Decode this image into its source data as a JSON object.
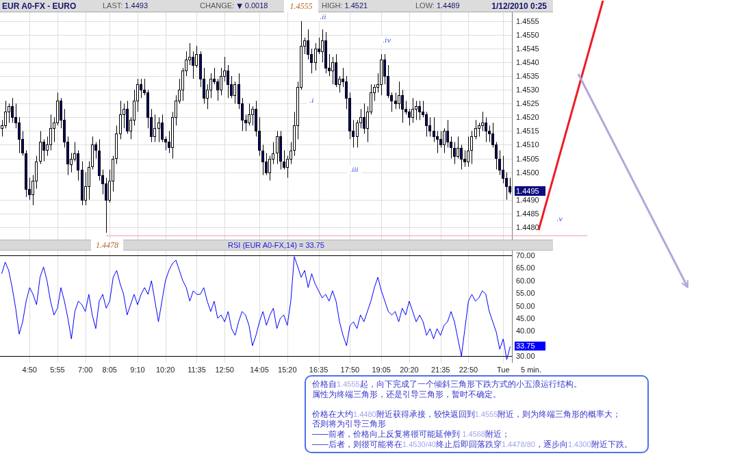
{
  "header": {
    "symbol": "EUR A0-FX - EURO",
    "last": {
      "label": "LAST:",
      "value": "1.4493"
    },
    "change": {
      "label": "CHANGE:",
      "arrow": "▼",
      "value": "0.0018"
    },
    "high_marker": "1.4555",
    "high": {
      "label": "HIGH:",
      "value": "1.4521"
    },
    "low": {
      "label": "LOW:",
      "value": "1.4489"
    },
    "datetime": "1/12/2010 0:25"
  },
  "price_chart": {
    "last_price_tag": "1.4495",
    "low_marker": "1.4478",
    "wave_labels": [
      ".i",
      ".ii",
      ".iii",
      ".iv",
      ".v"
    ],
    "chart_data": {
      "type": "candlestick",
      "grid": true,
      "ylim": [
        1.44755,
        1.45582
      ],
      "yticks": [
        {
          "value": 1.4555,
          "label": "1.4555"
        },
        {
          "value": 1.455,
          "label": "1.4550"
        },
        {
          "value": 1.4545,
          "label": "1.4545"
        },
        {
          "value": 1.454,
          "label": "1.4540"
        },
        {
          "value": 1.4535,
          "label": "1.4535"
        },
        {
          "value": 1.453,
          "label": "1.4530"
        },
        {
          "value": 1.4525,
          "label": "1.4525"
        },
        {
          "value": 1.452,
          "label": "1.4520"
        },
        {
          "value": 1.4515,
          "label": "1.4515"
        },
        {
          "value": 1.451,
          "label": "1.4510"
        },
        {
          "value": 1.4505,
          "label": "1.4505"
        },
        {
          "value": 1.45,
          "label": "1.4500"
        },
        {
          "value": 1.449,
          "label": "1.4490"
        },
        {
          "value": 1.4485,
          "label": "1.4485"
        },
        {
          "value": 1.448,
          "label": "1.4480"
        }
      ],
      "ohlc": [
        [
          1.4516,
          1.4519,
          1.4513,
          1.4517
        ],
        [
          1.4517,
          1.4526,
          1.4516,
          1.4522
        ],
        [
          1.4522,
          1.4525,
          1.4518,
          1.4524
        ],
        [
          1.4524,
          1.4527,
          1.4518,
          1.452
        ],
        [
          1.452,
          1.4525,
          1.4516,
          1.4518
        ],
        [
          1.4518,
          1.452,
          1.4507,
          1.4512
        ],
        [
          1.4512,
          1.4515,
          1.4506,
          1.4507
        ],
        [
          1.4507,
          1.4508,
          1.4491,
          1.4494
        ],
        [
          1.4494,
          1.4498,
          1.449,
          1.4492
        ],
        [
          1.4492,
          1.4499,
          1.4488,
          1.4497
        ],
        [
          1.4497,
          1.4506,
          1.4494,
          1.4504
        ],
        [
          1.4504,
          1.4515,
          1.4503,
          1.4511
        ],
        [
          1.4511,
          1.4512,
          1.4504,
          1.4508
        ],
        [
          1.4508,
          1.4513,
          1.4506,
          1.451
        ],
        [
          1.451,
          1.4521,
          1.4508,
          1.4516
        ],
        [
          1.4516,
          1.452,
          1.4511,
          1.4518
        ],
        [
          1.4518,
          1.4529,
          1.4517,
          1.4526
        ],
        [
          1.4526,
          1.4527,
          1.4516,
          1.4519
        ],
        [
          1.4519,
          1.4523,
          1.4509,
          1.4511
        ],
        [
          1.4511,
          1.4513,
          1.4499,
          1.4503
        ],
        [
          1.4503,
          1.4507,
          1.45,
          1.4505
        ],
        [
          1.4505,
          1.4511,
          1.4504,
          1.4507
        ],
        [
          1.4507,
          1.4508,
          1.4497,
          1.4501
        ],
        [
          1.4501,
          1.4504,
          1.4488,
          1.449
        ],
        [
          1.449,
          1.45,
          1.4488,
          1.4495
        ],
        [
          1.4495,
          1.4504,
          1.449,
          1.4502
        ],
        [
          1.4502,
          1.4513,
          1.4501,
          1.451
        ],
        [
          1.451,
          1.4511,
          1.4505,
          1.4508
        ],
        [
          1.4508,
          1.4512,
          1.4497,
          1.4499
        ],
        [
          1.4499,
          1.4501,
          1.4492,
          1.4496
        ],
        [
          1.4496,
          1.4498,
          1.4478,
          1.449
        ],
        [
          1.449,
          1.4501,
          1.4489,
          1.4497
        ],
        [
          1.4497,
          1.4506,
          1.4493,
          1.4505
        ],
        [
          1.4505,
          1.4517,
          1.4503,
          1.4514
        ],
        [
          1.4514,
          1.4526,
          1.4512,
          1.4521
        ],
        [
          1.4521,
          1.4525,
          1.4516,
          1.4523
        ],
        [
          1.4523,
          1.4526,
          1.4514,
          1.4515
        ],
        [
          1.4515,
          1.452,
          1.4512,
          1.4519
        ],
        [
          1.4519,
          1.453,
          1.4517,
          1.4526
        ],
        [
          1.4526,
          1.4534,
          1.4522,
          1.4532
        ],
        [
          1.4532,
          1.4534,
          1.4527,
          1.453
        ],
        [
          1.453,
          1.4534,
          1.4528,
          1.4529
        ],
        [
          1.4529,
          1.453,
          1.4516,
          1.452
        ],
        [
          1.452,
          1.4523,
          1.4511,
          1.4513
        ],
        [
          1.4513,
          1.4521,
          1.4511,
          1.4516
        ],
        [
          1.4516,
          1.452,
          1.4511,
          1.4518
        ],
        [
          1.4518,
          1.4521,
          1.4511,
          1.4512
        ],
        [
          1.4512,
          1.4513,
          1.4508,
          1.4511
        ],
        [
          1.4511,
          1.4515,
          1.4507,
          1.4509
        ],
        [
          1.4509,
          1.4522,
          1.4505,
          1.452
        ],
        [
          1.452,
          1.4528,
          1.4517,
          1.4526
        ],
        [
          1.4526,
          1.4534,
          1.4525,
          1.453
        ],
        [
          1.453,
          1.4538,
          1.4526,
          1.4537
        ],
        [
          1.4537,
          1.4544,
          1.4535,
          1.4541
        ],
        [
          1.4541,
          1.4547,
          1.4539,
          1.4542
        ],
        [
          1.4542,
          1.4544,
          1.4534,
          1.4539
        ],
        [
          1.4539,
          1.4546,
          1.4538,
          1.4543
        ],
        [
          1.4543,
          1.4544,
          1.4531,
          1.4534
        ],
        [
          1.4534,
          1.4538,
          1.4525,
          1.4527
        ],
        [
          1.4527,
          1.4532,
          1.4523,
          1.453
        ],
        [
          1.453,
          1.4536,
          1.4527,
          1.4534
        ],
        [
          1.4534,
          1.4538,
          1.4532,
          1.4533
        ],
        [
          1.4533,
          1.4534,
          1.4526,
          1.453
        ],
        [
          1.453,
          1.4538,
          1.4528,
          1.4535
        ],
        [
          1.4535,
          1.4542,
          1.4533,
          1.4537
        ],
        [
          1.4537,
          1.4539,
          1.4527,
          1.4532
        ],
        [
          1.4532,
          1.4535,
          1.4527,
          1.4528
        ],
        [
          1.4528,
          1.4533,
          1.4525,
          1.4532
        ],
        [
          1.4532,
          1.4536,
          1.4523,
          1.4525
        ],
        [
          1.4525,
          1.4527,
          1.4515,
          1.4519
        ],
        [
          1.4519,
          1.4521,
          1.4515,
          1.4518
        ],
        [
          1.4518,
          1.4525,
          1.4517,
          1.4521
        ],
        [
          1.4521,
          1.4524,
          1.4517,
          1.4523
        ],
        [
          1.4523,
          1.4526,
          1.4513,
          1.4515
        ],
        [
          1.4515,
          1.452,
          1.4506,
          1.4508
        ],
        [
          1.4508,
          1.451,
          1.4499,
          1.4504
        ],
        [
          1.4504,
          1.4507,
          1.4499,
          1.45
        ],
        [
          1.45,
          1.4506,
          1.4497,
          1.4505
        ],
        [
          1.4505,
          1.4511,
          1.4503,
          1.4507
        ],
        [
          1.4507,
          1.4515,
          1.4503,
          1.4513
        ],
        [
          1.4513,
          1.4515,
          1.4501,
          1.4504
        ],
        [
          1.4504,
          1.4508,
          1.4501,
          1.4502
        ],
        [
          1.4502,
          1.4506,
          1.4498,
          1.4505
        ],
        [
          1.4505,
          1.4511,
          1.4503,
          1.4508
        ],
        [
          1.4508,
          1.4522,
          1.4506,
          1.4517
        ],
        [
          1.4517,
          1.4533,
          1.4512,
          1.4531
        ],
        [
          1.4531,
          1.4555,
          1.453,
          1.4546
        ],
        [
          1.4546,
          1.4549,
          1.4543,
          1.4548
        ],
        [
          1.4548,
          1.4552,
          1.4541,
          1.4543
        ],
        [
          1.4543,
          1.4545,
          1.4536,
          1.454
        ],
        [
          1.454,
          1.4547,
          1.4537,
          1.4545
        ],
        [
          1.4545,
          1.4549,
          1.4543,
          1.4544
        ],
        [
          1.4544,
          1.4552,
          1.454,
          1.4548
        ],
        [
          1.4548,
          1.4551,
          1.4536,
          1.4538
        ],
        [
          1.4538,
          1.4543,
          1.4535,
          1.4537
        ],
        [
          1.4537,
          1.4542,
          1.4532,
          1.454
        ],
        [
          1.454,
          1.4543,
          1.4531,
          1.4532
        ],
        [
          1.4532,
          1.4535,
          1.4529,
          1.4534
        ],
        [
          1.4534,
          1.4538,
          1.4531,
          1.4533
        ],
        [
          1.4533,
          1.4535,
          1.4523,
          1.4527
        ],
        [
          1.4527,
          1.4529,
          1.4512,
          1.4515
        ],
        [
          1.4515,
          1.4519,
          1.4509,
          1.4513
        ],
        [
          1.4513,
          1.4519,
          1.4509,
          1.4518
        ],
        [
          1.4518,
          1.4523,
          1.4516,
          1.452
        ],
        [
          1.452,
          1.4525,
          1.4514,
          1.4516
        ],
        [
          1.4516,
          1.4524,
          1.4511,
          1.4522
        ],
        [
          1.4522,
          1.4532,
          1.4521,
          1.4529
        ],
        [
          1.4529,
          1.4532,
          1.4526,
          1.4531
        ],
        [
          1.4531,
          1.4536,
          1.4529,
          1.4532
        ],
        [
          1.4532,
          1.4543,
          1.4528,
          1.4541
        ],
        [
          1.4541,
          1.4543,
          1.4532,
          1.4535
        ],
        [
          1.4535,
          1.4539,
          1.4527,
          1.4528
        ],
        [
          1.4528,
          1.4529,
          1.4522,
          1.4526
        ],
        [
          1.4526,
          1.4529,
          1.4523,
          1.4525
        ],
        [
          1.4525,
          1.4533,
          1.4523,
          1.4528
        ],
        [
          1.4528,
          1.453,
          1.4518,
          1.4523
        ],
        [
          1.4523,
          1.4526,
          1.4521,
          1.4522
        ],
        [
          1.4522,
          1.4523,
          1.4517,
          1.452
        ],
        [
          1.452,
          1.4527,
          1.4518,
          1.4523
        ],
        [
          1.4523,
          1.4526,
          1.4519,
          1.4524
        ],
        [
          1.4524,
          1.4526,
          1.4519,
          1.4522
        ],
        [
          1.4522,
          1.4526,
          1.452,
          1.4521
        ],
        [
          1.4521,
          1.4522,
          1.4513,
          1.4517
        ],
        [
          1.4517,
          1.452,
          1.4513,
          1.4515
        ],
        [
          1.4515,
          1.452,
          1.4511,
          1.4513
        ],
        [
          1.4513,
          1.4515,
          1.4507,
          1.4512
        ],
        [
          1.4512,
          1.4515,
          1.4509,
          1.451
        ],
        [
          1.451,
          1.4516,
          1.4507,
          1.4515
        ],
        [
          1.4515,
          1.4519,
          1.4509,
          1.4511
        ],
        [
          1.4511,
          1.4513,
          1.4505,
          1.4509
        ],
        [
          1.4509,
          1.4511,
          1.4503,
          1.4506
        ],
        [
          1.4506,
          1.4513,
          1.4505,
          1.4509
        ],
        [
          1.4509,
          1.451,
          1.4501,
          1.4505
        ],
        [
          1.4505,
          1.4508,
          1.4502,
          1.4504
        ],
        [
          1.4504,
          1.4513,
          1.4502,
          1.4508
        ],
        [
          1.4508,
          1.4515,
          1.4503,
          1.4513
        ],
        [
          1.4513,
          1.4519,
          1.4512,
          1.4516
        ],
        [
          1.4516,
          1.4518,
          1.4513,
          1.4517
        ],
        [
          1.4517,
          1.4522,
          1.4515,
          1.4518
        ],
        [
          1.4518,
          1.452,
          1.4511,
          1.4515
        ],
        [
          1.4515,
          1.4517,
          1.4511,
          1.4514
        ],
        [
          1.4514,
          1.4518,
          1.4509,
          1.451
        ],
        [
          1.451,
          1.4511,
          1.4501,
          1.4505
        ],
        [
          1.4505,
          1.4508,
          1.4499,
          1.4501
        ],
        [
          1.4501,
          1.4506,
          1.4496,
          1.4498
        ],
        [
          1.4498,
          1.45,
          1.449,
          1.4495
        ],
        [
          1.4495,
          1.4498,
          1.4492,
          1.4493
        ]
      ]
    }
  },
  "rsi_panel": {
    "last_value_tag": "33.75",
    "chart_data": {
      "type": "line",
      "title": "RSI (EUR A0-FX,14) = 33.75",
      "grid": true,
      "categories": [
        null,
        null,
        null,
        null,
        null,
        null,
        null,
        null,
        "4:50",
        null,
        null,
        null,
        null,
        null,
        null,
        null,
        "5:55",
        null,
        null,
        null,
        null,
        null,
        null,
        null,
        "7:00",
        null,
        null,
        null,
        null,
        null,
        null,
        "8:05",
        null,
        null,
        null,
        null,
        null,
        null,
        null,
        "9:10",
        null,
        null,
        null,
        null,
        null,
        null,
        null,
        "10:20",
        null,
        null,
        null,
        null,
        null,
        null,
        null,
        null,
        "11:35",
        null,
        null,
        null,
        null,
        null,
        null,
        null,
        "12:50",
        null,
        null,
        null,
        null,
        null,
        null,
        null,
        null,
        null,
        "14:05",
        null,
        null,
        null,
        null,
        null,
        null,
        null,
        "15:20",
        null,
        null,
        null,
        null,
        null,
        null,
        null,
        null,
        "16:35",
        null,
        null,
        null,
        null,
        null,
        null,
        null,
        null,
        "17:50",
        null,
        null,
        null,
        null,
        null,
        null,
        null,
        null,
        "19:05",
        null,
        null,
        null,
        null,
        null,
        null,
        null,
        "20:20",
        null,
        null,
        null,
        null,
        null,
        null,
        null,
        null,
        "21:35",
        null,
        null,
        null,
        null,
        null,
        null,
        null,
        "22:50",
        null,
        null,
        null,
        null,
        null,
        null,
        null,
        null,
        null,
        "Tue",
        null,
        null
      ],
      "ylim": [
        27.3,
        71.9
      ],
      "yticks": [
        {
          "value": 70,
          "label": "70.00"
        },
        {
          "value": 65,
          "label": "65.00"
        },
        {
          "value": 60,
          "label": "60.00"
        },
        {
          "value": 55,
          "label": "55.00"
        },
        {
          "value": 50,
          "label": "50.00"
        },
        {
          "value": 45,
          "label": "45.00"
        },
        {
          "value": 40,
          "label": "40.00"
        },
        {
          "value": 30,
          "label": "30.00"
        }
      ],
      "series": [
        {
          "color": "#0000ff",
          "values": [
            62.7,
            67.3,
            64.0,
            57.2,
            49.0,
            38.7,
            43.6,
            51.8,
            57.2,
            54.5,
            50.4,
            61.3,
            65.4,
            59.9,
            51.8,
            46.3,
            49.0,
            57.2,
            51.8,
            45.0,
            36.8,
            47.7,
            51.8,
            50.4,
            47.7,
            54.5,
            46.3,
            40.9,
            51.8,
            54.5,
            49.0,
            51.8,
            61.3,
            64.0,
            58.6,
            54.5,
            46.3,
            50.4,
            54.5,
            50.4,
            54.5,
            57.2,
            54.5,
            59.9,
            51.8,
            43.6,
            51.8,
            59.9,
            64.0,
            66.7,
            68.1,
            64.0,
            59.9,
            57.2,
            51.8,
            55.9,
            54.5,
            54.5,
            57.2,
            51.8,
            47.7,
            51.8,
            45.0,
            46.3,
            43.6,
            47.7,
            40.9,
            38.2,
            43.6,
            47.7,
            46.3,
            42.2,
            34.1,
            38.2,
            43.6,
            47.7,
            42.2,
            46.3,
            49.0,
            40.9,
            45.0,
            46.3,
            42.2,
            51.8,
            69.5,
            65.4,
            61.3,
            64.0,
            57.2,
            62.7,
            58.6,
            55.9,
            53.1,
            54.5,
            51.8,
            55.9,
            51.8,
            43.6,
            38.2,
            34.1,
            42.2,
            43.6,
            40.9,
            46.3,
            43.6,
            47.7,
            51.8,
            57.2,
            61.3,
            55.9,
            51.8,
            47.7,
            46.3,
            47.7,
            43.6,
            49.0,
            46.3,
            51.8,
            47.7,
            43.6,
            46.3,
            43.6,
            38.2,
            40.9,
            36.8,
            40.9,
            38.2,
            42.2,
            43.6,
            47.7,
            43.6,
            36.8,
            30.0,
            40.9,
            51.8,
            54.5,
            51.8,
            53.1,
            55.9,
            54.5,
            47.7,
            43.6,
            39.5,
            32.7,
            36.8,
            28.6,
            33.8
          ]
        }
      ]
    }
  },
  "x_axis": {
    "interval_label": "5 min."
  },
  "note": {
    "paragraphs": [
      {
        "lines": [
          [
            {
              "text": "价格自",
              "kind": "plain"
            },
            {
              "text": "1.4555",
              "kind": "figure"
            },
            {
              "text": "起，向下完成了一个倾斜三角形下跌方式的小五浪运行结构。",
              "kind": "plain"
            }
          ],
          [
            {
              "text": "属性为终端三角形，还是引导三角形，暂时不确定。",
              "kind": "plain"
            }
          ]
        ]
      },
      {
        "lines": [
          [
            {
              "text": "价格在大约",
              "kind": "plain"
            },
            {
              "text": "1.4480",
              "kind": "figure"
            },
            {
              "text": "附近获得承接，较快返回到",
              "kind": "plain"
            },
            {
              "text": "1.4555",
              "kind": "figure"
            },
            {
              "text": "附近，则为终端三角形的概率大；",
              "kind": "plain"
            }
          ],
          [
            {
              "text": "否则将为引导三角形",
              "kind": "plain"
            }
          ],
          [
            {
              "text": "——前者，价格向上反复将很可能延伸到 ",
              "kind": "plain"
            },
            {
              "text": "1.4568",
              "kind": "figure"
            },
            {
              "text": "附近；",
              "kind": "plain"
            }
          ],
          [
            {
              "text": "——后者，则很可能将在",
              "kind": "plain"
            },
            {
              "text": "1.4530/40",
              "kind": "figure"
            },
            {
              "text": "终止后即回落跌穿",
              "kind": "plain"
            },
            {
              "text": "1.4478/80",
              "kind": "figure"
            },
            {
              "text": "，逐步向",
              "kind": "plain"
            },
            {
              "text": "1.4300",
              "kind": "figure"
            },
            {
              "text": "附近下跌。",
              "kind": "plain"
            }
          ]
        ]
      }
    ]
  }
}
